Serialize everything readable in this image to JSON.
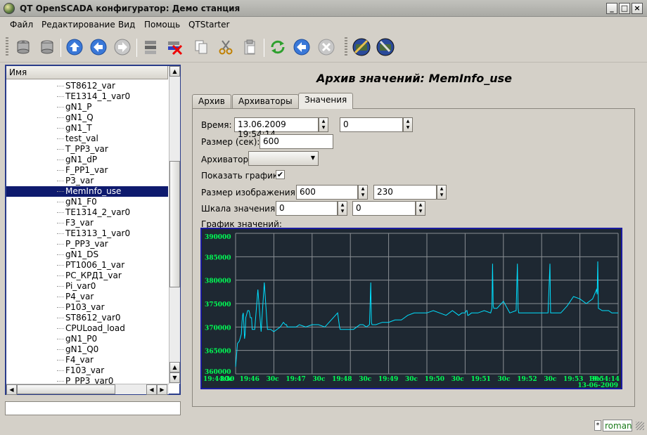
{
  "window": {
    "title": "QT OpenSCADA конфигуратор: Демо станция"
  },
  "menu": [
    "Файл",
    "Редактирование",
    "Вид",
    "Помощь",
    "QTStarter"
  ],
  "toolbar": {
    "buttons": [
      "db-load-icon",
      "db-save-icon",
      "up-icon",
      "back-icon",
      "forward-icon",
      "add-item-icon",
      "delete-item-icon",
      "copy-icon",
      "cut-icon",
      "paste-icon",
      "refresh-icon",
      "start-icon",
      "stop-icon",
      "tool-1-icon",
      "tool-2-icon"
    ]
  },
  "tree": {
    "header": "Имя",
    "items": [
      "ST8612_var",
      "TE1314_1_var0",
      "gN1_P",
      "gN1_Q",
      "gN1_T",
      "test_val",
      "T_PP3_var",
      "gN1_dP",
      "F_PP1_var",
      "P3_var",
      "MemInfo_use",
      "gN1_F0",
      "TE1314_2_var0",
      "F3_var",
      "TE1313_1_var0",
      "P_PP3_var",
      "gN1_DS",
      "PT1006_1_var",
      "PC_КРД1_var",
      "Pi_var0",
      "P4_var",
      "P103_var",
      "ST8612_var0",
      "CPULoad_load",
      "gN1_P0",
      "gN1_Q0",
      "F4_var",
      "F103_var",
      "P_PP3_var0"
    ],
    "selected": "MemInfo_use"
  },
  "page": {
    "title": "Архив значений: MemInfo_use",
    "tabs": [
      "Архив",
      "Архиваторы",
      "Значения"
    ],
    "active_tab": "Значения"
  },
  "form": {
    "time_label": "Время:",
    "time_value": "13.06.2009 19:54:14",
    "time_offset": "0",
    "size_label": "Размер (сек):",
    "size_value": "600",
    "archiver_label": "Архиватор:",
    "archiver_value": "",
    "show_graph_label": "Показать график:",
    "show_graph_checked": true,
    "img_size_label": "Размер изображения:",
    "img_width": "600",
    "img_height": "230",
    "scale_label": "Шкала значения:",
    "scale_min": "0",
    "scale_max": "0",
    "graph_label": "График значений:"
  },
  "colors": {
    "chart_bg": "#1e2832",
    "grid": "#8a8f94",
    "line": "#00e0ff",
    "text": "#00ff55",
    "selection": "#0e1a6e"
  },
  "chart_data": {
    "type": "line",
    "y_ticks": [
      "390000",
      "385000",
      "380000",
      "375000",
      "370000",
      "365000",
      "360000"
    ],
    "ylim": [
      360000,
      390000
    ],
    "x_ticks": [
      "19:44:30",
      "30c",
      "19:46",
      "30c",
      "19:47",
      "30c",
      "19:48",
      "30c",
      "19:49",
      "30c",
      "19:50",
      "30c",
      "19:51",
      "30c",
      "19:52",
      "30c",
      "19:53",
      "30c",
      "19:54:14"
    ],
    "x_date": "13-06-2009",
    "series": [
      {
        "x": [
          0,
          3,
          6,
          9,
          10,
          11,
          12,
          13,
          14,
          15,
          16,
          17,
          18,
          19,
          20,
          21,
          22,
          23,
          24,
          25,
          26,
          30,
          35,
          40,
          45,
          50,
          55,
          60,
          70,
          75,
          78,
          79,
          80,
          81,
          85,
          90,
          95,
          100,
          110,
          120,
          130,
          140,
          150,
          160,
          163,
          164,
          165,
          166,
          170,
          180,
          185,
          190,
          195,
          200,
          205,
          210,
          212,
          213,
          214,
          215,
          220,
          230,
          240,
          250,
          260,
          265,
          270,
          280,
          290,
          300,
          310,
          320,
          330,
          340,
          345,
          350,
          355,
          360,
          362,
          363,
          364,
          365,
          370,
          380,
          390,
          400,
          402,
          403,
          404,
          405,
          410,
          420,
          430,
          440,
          442,
          443,
          444,
          445,
          450,
          460,
          470,
          480,
          490,
          493,
          494,
          495,
          496,
          500,
          510,
          520,
          530,
          540,
          550,
          560,
          566,
          567,
          568,
          569,
          575,
          580,
          585,
          590,
          600
        ],
        "y": [
          361500,
          366500,
          367000,
          368500,
          371000,
          372500,
          373000,
          370500,
          367500,
          368500,
          372000,
          372500,
          373000,
          373500,
          373500,
          373500,
          373000,
          372000,
          372000,
          372000,
          369500,
          369500,
          378000,
          369000,
          379500,
          369500,
          369500,
          369000,
          370000,
          371000,
          370500,
          370500,
          370500,
          370000,
          370000,
          370000,
          370000,
          370500,
          370000,
          370500,
          370500,
          370000,
          371500,
          373000,
          370000,
          369500,
          369500,
          369500,
          369500,
          369500,
          369500,
          370000,
          370500,
          370500,
          370000,
          370500,
          379500,
          371000,
          370500,
          370500,
          370500,
          371000,
          371000,
          371500,
          371500,
          372000,
          372500,
          373000,
          373000,
          373000,
          373500,
          373000,
          372500,
          373500,
          373000,
          372500,
          373000,
          373000,
          373500,
          373500,
          372500,
          372500,
          373000,
          373000,
          373500,
          373000,
          374000,
          383500,
          374500,
          374000,
          374000,
          375500,
          373000,
          373500,
          383500,
          374000,
          373000,
          373000,
          373000,
          373000,
          373000,
          373000,
          373000,
          383500,
          373000,
          373000,
          373000,
          373000,
          373000,
          374500,
          376500,
          376000,
          375000,
          376000,
          378000,
          377000,
          384000,
          374000,
          373500,
          373500,
          373500,
          373000,
          373000
        ]
      }
    ]
  }
}
